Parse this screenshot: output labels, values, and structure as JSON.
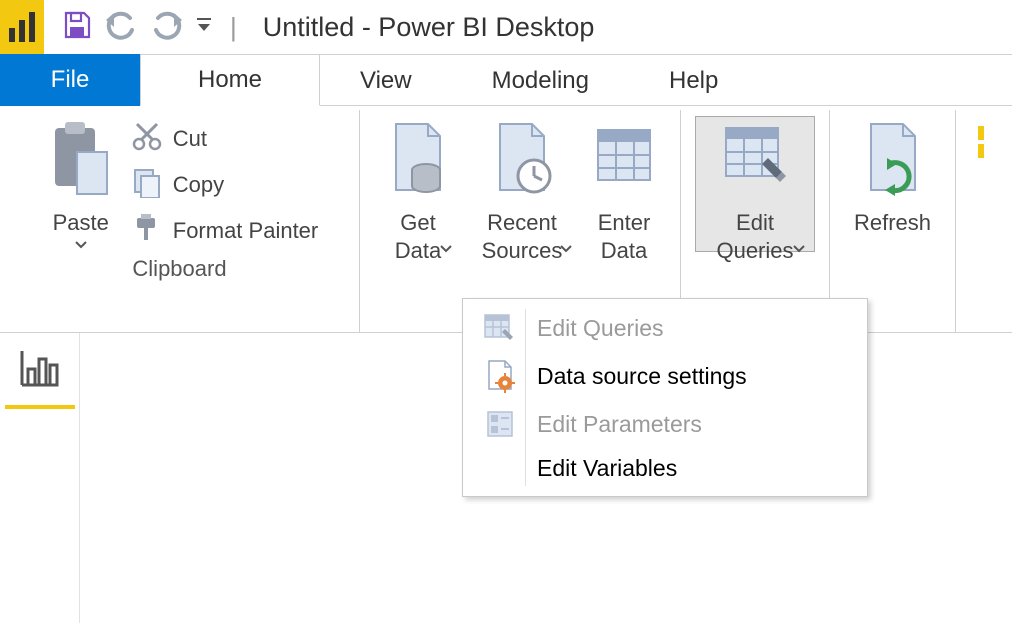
{
  "title": "Untitled - Power BI Desktop",
  "qat": {
    "save": "Save",
    "undo": "Undo",
    "redo": "Redo"
  },
  "tabs": {
    "file": "File",
    "home": "Home",
    "view": "View",
    "modeling": "Modeling",
    "help": "Help"
  },
  "ribbon": {
    "clipboard": {
      "group": "Clipboard",
      "paste": "Paste",
      "cut": "Cut",
      "copy": "Copy",
      "formatPainter": "Format Painter"
    },
    "data": {
      "getData": "Get\nData",
      "recentSources": "Recent\nSources",
      "enterData": "Enter\nData",
      "editQueries": "Edit\nQueries",
      "refresh": "Refresh"
    }
  },
  "menu": {
    "editQueries": "Edit Queries",
    "dataSourceSettings": "Data source settings",
    "editParameters": "Edit Parameters",
    "editVariables": "Edit Variables"
  }
}
